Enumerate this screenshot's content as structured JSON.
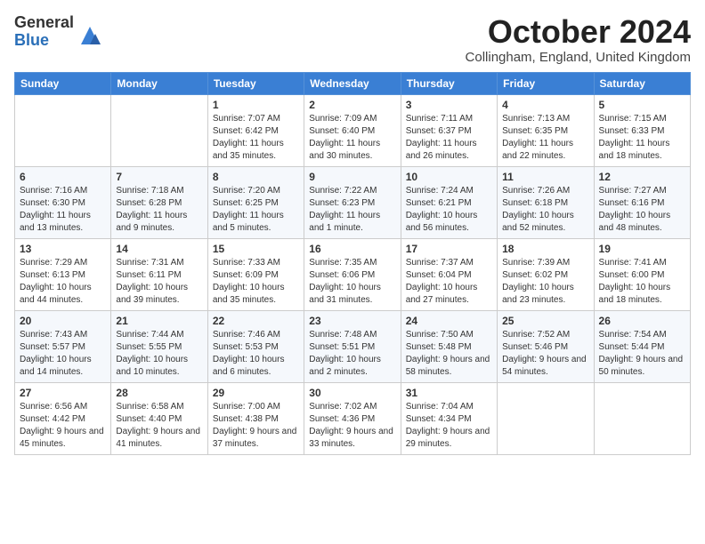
{
  "logo": {
    "general": "General",
    "blue": "Blue"
  },
  "title": "October 2024",
  "location": "Collingham, England, United Kingdom",
  "days": [
    "Sunday",
    "Monday",
    "Tuesday",
    "Wednesday",
    "Thursday",
    "Friday",
    "Saturday"
  ],
  "weeks": [
    [
      {
        "day": "",
        "sunrise": "",
        "sunset": "",
        "daylight": ""
      },
      {
        "day": "",
        "sunrise": "",
        "sunset": "",
        "daylight": ""
      },
      {
        "day": "1",
        "sunrise": "Sunrise: 7:07 AM",
        "sunset": "Sunset: 6:42 PM",
        "daylight": "Daylight: 11 hours and 35 minutes."
      },
      {
        "day": "2",
        "sunrise": "Sunrise: 7:09 AM",
        "sunset": "Sunset: 6:40 PM",
        "daylight": "Daylight: 11 hours and 30 minutes."
      },
      {
        "day": "3",
        "sunrise": "Sunrise: 7:11 AM",
        "sunset": "Sunset: 6:37 PM",
        "daylight": "Daylight: 11 hours and 26 minutes."
      },
      {
        "day": "4",
        "sunrise": "Sunrise: 7:13 AM",
        "sunset": "Sunset: 6:35 PM",
        "daylight": "Daylight: 11 hours and 22 minutes."
      },
      {
        "day": "5",
        "sunrise": "Sunrise: 7:15 AM",
        "sunset": "Sunset: 6:33 PM",
        "daylight": "Daylight: 11 hours and 18 minutes."
      }
    ],
    [
      {
        "day": "6",
        "sunrise": "Sunrise: 7:16 AM",
        "sunset": "Sunset: 6:30 PM",
        "daylight": "Daylight: 11 hours and 13 minutes."
      },
      {
        "day": "7",
        "sunrise": "Sunrise: 7:18 AM",
        "sunset": "Sunset: 6:28 PM",
        "daylight": "Daylight: 11 hours and 9 minutes."
      },
      {
        "day": "8",
        "sunrise": "Sunrise: 7:20 AM",
        "sunset": "Sunset: 6:25 PM",
        "daylight": "Daylight: 11 hours and 5 minutes."
      },
      {
        "day": "9",
        "sunrise": "Sunrise: 7:22 AM",
        "sunset": "Sunset: 6:23 PM",
        "daylight": "Daylight: 11 hours and 1 minute."
      },
      {
        "day": "10",
        "sunrise": "Sunrise: 7:24 AM",
        "sunset": "Sunset: 6:21 PM",
        "daylight": "Daylight: 10 hours and 56 minutes."
      },
      {
        "day": "11",
        "sunrise": "Sunrise: 7:26 AM",
        "sunset": "Sunset: 6:18 PM",
        "daylight": "Daylight: 10 hours and 52 minutes."
      },
      {
        "day": "12",
        "sunrise": "Sunrise: 7:27 AM",
        "sunset": "Sunset: 6:16 PM",
        "daylight": "Daylight: 10 hours and 48 minutes."
      }
    ],
    [
      {
        "day": "13",
        "sunrise": "Sunrise: 7:29 AM",
        "sunset": "Sunset: 6:13 PM",
        "daylight": "Daylight: 10 hours and 44 minutes."
      },
      {
        "day": "14",
        "sunrise": "Sunrise: 7:31 AM",
        "sunset": "Sunset: 6:11 PM",
        "daylight": "Daylight: 10 hours and 39 minutes."
      },
      {
        "day": "15",
        "sunrise": "Sunrise: 7:33 AM",
        "sunset": "Sunset: 6:09 PM",
        "daylight": "Daylight: 10 hours and 35 minutes."
      },
      {
        "day": "16",
        "sunrise": "Sunrise: 7:35 AM",
        "sunset": "Sunset: 6:06 PM",
        "daylight": "Daylight: 10 hours and 31 minutes."
      },
      {
        "day": "17",
        "sunrise": "Sunrise: 7:37 AM",
        "sunset": "Sunset: 6:04 PM",
        "daylight": "Daylight: 10 hours and 27 minutes."
      },
      {
        "day": "18",
        "sunrise": "Sunrise: 7:39 AM",
        "sunset": "Sunset: 6:02 PM",
        "daylight": "Daylight: 10 hours and 23 minutes."
      },
      {
        "day": "19",
        "sunrise": "Sunrise: 7:41 AM",
        "sunset": "Sunset: 6:00 PM",
        "daylight": "Daylight: 10 hours and 18 minutes."
      }
    ],
    [
      {
        "day": "20",
        "sunrise": "Sunrise: 7:43 AM",
        "sunset": "Sunset: 5:57 PM",
        "daylight": "Daylight: 10 hours and 14 minutes."
      },
      {
        "day": "21",
        "sunrise": "Sunrise: 7:44 AM",
        "sunset": "Sunset: 5:55 PM",
        "daylight": "Daylight: 10 hours and 10 minutes."
      },
      {
        "day": "22",
        "sunrise": "Sunrise: 7:46 AM",
        "sunset": "Sunset: 5:53 PM",
        "daylight": "Daylight: 10 hours and 6 minutes."
      },
      {
        "day": "23",
        "sunrise": "Sunrise: 7:48 AM",
        "sunset": "Sunset: 5:51 PM",
        "daylight": "Daylight: 10 hours and 2 minutes."
      },
      {
        "day": "24",
        "sunrise": "Sunrise: 7:50 AM",
        "sunset": "Sunset: 5:48 PM",
        "daylight": "Daylight: 9 hours and 58 minutes."
      },
      {
        "day": "25",
        "sunrise": "Sunrise: 7:52 AM",
        "sunset": "Sunset: 5:46 PM",
        "daylight": "Daylight: 9 hours and 54 minutes."
      },
      {
        "day": "26",
        "sunrise": "Sunrise: 7:54 AM",
        "sunset": "Sunset: 5:44 PM",
        "daylight": "Daylight: 9 hours and 50 minutes."
      }
    ],
    [
      {
        "day": "27",
        "sunrise": "Sunrise: 6:56 AM",
        "sunset": "Sunset: 4:42 PM",
        "daylight": "Daylight: 9 hours and 45 minutes."
      },
      {
        "day": "28",
        "sunrise": "Sunrise: 6:58 AM",
        "sunset": "Sunset: 4:40 PM",
        "daylight": "Daylight: 9 hours and 41 minutes."
      },
      {
        "day": "29",
        "sunrise": "Sunrise: 7:00 AM",
        "sunset": "Sunset: 4:38 PM",
        "daylight": "Daylight: 9 hours and 37 minutes."
      },
      {
        "day": "30",
        "sunrise": "Sunrise: 7:02 AM",
        "sunset": "Sunset: 4:36 PM",
        "daylight": "Daylight: 9 hours and 33 minutes."
      },
      {
        "day": "31",
        "sunrise": "Sunrise: 7:04 AM",
        "sunset": "Sunset: 4:34 PM",
        "daylight": "Daylight: 9 hours and 29 minutes."
      },
      {
        "day": "",
        "sunrise": "",
        "sunset": "",
        "daylight": ""
      },
      {
        "day": "",
        "sunrise": "",
        "sunset": "",
        "daylight": ""
      }
    ]
  ]
}
